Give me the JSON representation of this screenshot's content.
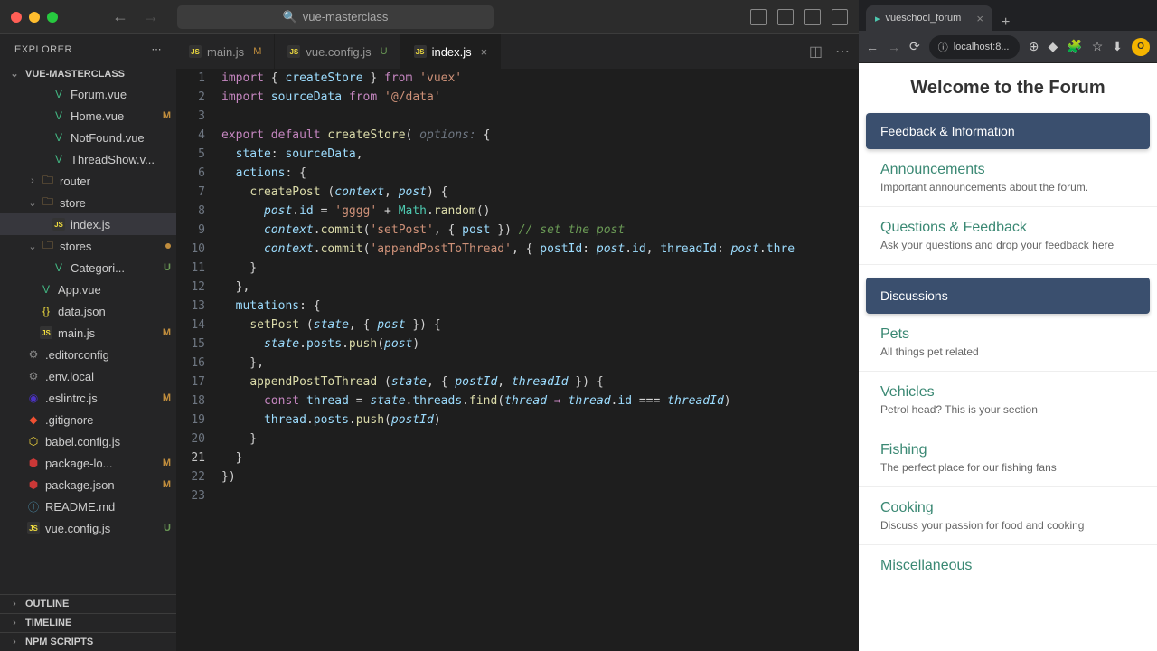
{
  "titlebar": {
    "project": "vue-masterclass"
  },
  "explorer": {
    "title": "EXPLORER",
    "project": "VUE-MASTERCLASS"
  },
  "fileTree": [
    {
      "name": "Forum.vue",
      "icon": "vue",
      "indent": 56,
      "badge": ""
    },
    {
      "name": "Home.vue",
      "icon": "vue",
      "indent": 56,
      "badge": "M"
    },
    {
      "name": "NotFound.vue",
      "icon": "vue",
      "indent": 56,
      "badge": ""
    },
    {
      "name": "ThreadShow.v...",
      "icon": "vue",
      "indent": 56,
      "badge": ""
    },
    {
      "name": "router",
      "icon": "folder",
      "indent": 28,
      "chevron": "›",
      "badge": ""
    },
    {
      "name": "store",
      "icon": "folder",
      "indent": 28,
      "chevron": "⌄",
      "badge": ""
    },
    {
      "name": "index.js",
      "icon": "js",
      "indent": 56,
      "badge": "",
      "active": true
    },
    {
      "name": "stores",
      "icon": "folder",
      "indent": 28,
      "chevron": "⌄",
      "badge": "",
      "dot": true
    },
    {
      "name": "Categori...",
      "icon": "vue",
      "indent": 56,
      "badge": "U"
    },
    {
      "name": "App.vue",
      "icon": "vue",
      "indent": 42,
      "badge": ""
    },
    {
      "name": "data.json",
      "icon": "json",
      "indent": 42,
      "badge": ""
    },
    {
      "name": "main.js",
      "icon": "js",
      "indent": 42,
      "badge": "M"
    },
    {
      "name": ".editorconfig",
      "icon": "cfg",
      "indent": 28,
      "badge": ""
    },
    {
      "name": ".env.local",
      "icon": "cfg",
      "indent": 28,
      "badge": ""
    },
    {
      "name": ".eslintrc.js",
      "icon": "eslint",
      "indent": 28,
      "badge": "M"
    },
    {
      "name": ".gitignore",
      "icon": "git",
      "indent": 28,
      "badge": ""
    },
    {
      "name": "babel.config.js",
      "icon": "babel",
      "indent": 28,
      "badge": ""
    },
    {
      "name": "package-lo...",
      "icon": "npm",
      "indent": 28,
      "badge": "M"
    },
    {
      "name": "package.json",
      "icon": "npm",
      "indent": 28,
      "badge": "M"
    },
    {
      "name": "README.md",
      "icon": "info",
      "indent": 28,
      "badge": ""
    },
    {
      "name": "vue.config.js",
      "icon": "js",
      "indent": 28,
      "badge": "U"
    }
  ],
  "sections": {
    "outline": "OUTLINE",
    "timeline": "TIMELINE",
    "npm": "NPM SCRIPTS"
  },
  "tabs": [
    {
      "name": "main.js",
      "badge": "M",
      "icon": "js"
    },
    {
      "name": "vue.config.js",
      "badge": "U",
      "icon": "js"
    },
    {
      "name": "index.js",
      "badge": "",
      "icon": "js",
      "active": true,
      "close": true
    }
  ],
  "lineNumbers": [
    "1",
    "2",
    "3",
    "4",
    "5",
    "6",
    "7",
    "8",
    "9",
    "10",
    "11",
    "12",
    "13",
    "14",
    "15",
    "16",
    "17",
    "18",
    "19",
    "20",
    "21",
    "22",
    "23"
  ],
  "currentLine": 21,
  "browser": {
    "tabTitle": "vueschool_forum",
    "url": "localhost:8...",
    "pageTitle": "Welcome to the Forum",
    "categories": [
      {
        "name": "Feedback & Information",
        "forums": [
          {
            "title": "Announcements",
            "desc": "Important announcements about the forum."
          },
          {
            "title": "Questions & Feedback",
            "desc": "Ask your questions and drop your feedback here"
          }
        ]
      },
      {
        "name": "Discussions",
        "forums": [
          {
            "title": "Pets",
            "desc": "All things pet related"
          },
          {
            "title": "Vehicles",
            "desc": "Petrol head? This is your section"
          },
          {
            "title": "Fishing",
            "desc": "The perfect place for our fishing fans"
          },
          {
            "title": "Cooking",
            "desc": "Discuss your passion for food and cooking"
          },
          {
            "title": "Miscellaneous",
            "desc": ""
          }
        ]
      }
    ]
  }
}
